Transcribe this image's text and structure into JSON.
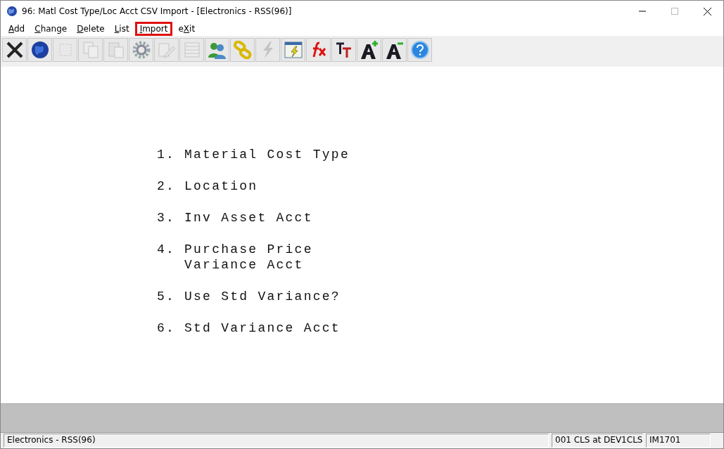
{
  "window": {
    "title": "96: Matl Cost Type/Loc Acct CSV Import - [Electronics - RSS(96)]"
  },
  "menu": [
    {
      "key": "A",
      "post": "dd",
      "highlighted": false
    },
    {
      "key": "C",
      "post": "hange",
      "highlighted": false
    },
    {
      "key": "D",
      "post": "elete",
      "highlighted": false
    },
    {
      "key": "L",
      "post": "ist",
      "highlighted": false
    },
    {
      "key": "I",
      "post": "mport",
      "highlighted": true
    },
    {
      "pre": "e",
      "key": "X",
      "post": "it",
      "highlighted": false
    }
  ],
  "toolbar": [
    {
      "kind": "close",
      "disabled": false
    },
    {
      "kind": "globe",
      "disabled": false
    },
    {
      "kind": "select",
      "disabled": true
    },
    {
      "kind": "copy",
      "disabled": true
    },
    {
      "kind": "paste",
      "disabled": true
    },
    {
      "kind": "gear",
      "disabled": false
    },
    {
      "kind": "edit",
      "disabled": true
    },
    {
      "kind": "table",
      "disabled": true
    },
    {
      "kind": "users",
      "disabled": false
    },
    {
      "kind": "link",
      "disabled": false
    },
    {
      "kind": "bolt",
      "disabled": true
    },
    {
      "kind": "run",
      "disabled": false
    },
    {
      "kind": "fx",
      "disabled": false
    },
    {
      "kind": "font",
      "disabled": false
    },
    {
      "kind": "grow",
      "disabled": false
    },
    {
      "kind": "shrink",
      "disabled": false
    },
    {
      "kind": "help",
      "disabled": false
    }
  ],
  "fields": [
    {
      "number": "1.",
      "lines": [
        "Material Cost Type"
      ]
    },
    {
      "number": "2.",
      "lines": [
        "Location"
      ]
    },
    {
      "number": "3.",
      "lines": [
        "Inv Asset Acct"
      ]
    },
    {
      "number": "4.",
      "lines": [
        "Purchase Price",
        "Variance Acct"
      ]
    },
    {
      "number": "5.",
      "lines": [
        "Use Std Variance?"
      ]
    },
    {
      "number": "6.",
      "lines": [
        "Std Variance Acct"
      ]
    }
  ],
  "status_bar": {
    "company": "Electronics - RSS(96)",
    "session": "001 CLS at DEV1CLS",
    "program": "IM1701"
  }
}
